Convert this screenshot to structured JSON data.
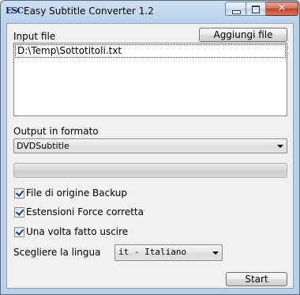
{
  "window": {
    "title": "Easy Subtitle Converter 1.2",
    "icon_label": "ESC",
    "title_icon": "esc-logo-icon",
    "controls": {
      "minimize_icon": "minimize-icon",
      "maximize_icon": "maximize-icon",
      "close_glyph": "✕"
    }
  },
  "input": {
    "label": "Input file",
    "add_button_label": "Aggiungi file",
    "files": [
      "D:\\Temp\\Sottotitoli.txt"
    ]
  },
  "output": {
    "label": "Output in formato",
    "selected_format": "DVDSubtitle"
  },
  "progress": {
    "value_percent": 0
  },
  "options": [
    {
      "label": "File di origine Backup",
      "checked": true
    },
    {
      "label": "Estensioni Force corretta",
      "checked": true
    },
    {
      "label": "Una volta fatto uscire",
      "checked": true
    }
  ],
  "language": {
    "label": "Scegliere la lingua",
    "selected": "it - Italiano"
  },
  "start_button_label": "Start",
  "colors": {
    "titlebar": "#b9d0e8",
    "client_background": "#f0f0f0",
    "close_button": "#c5432a",
    "checkmark": "#1a3f7a"
  }
}
